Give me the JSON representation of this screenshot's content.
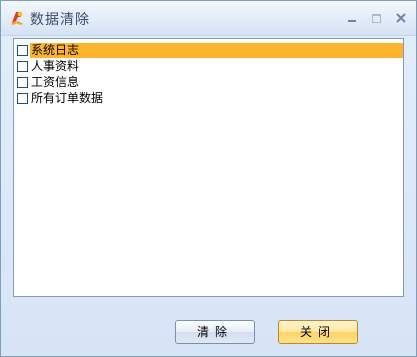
{
  "window": {
    "title": "数据清除",
    "app_icon": "app-logo-icon",
    "controls": {
      "minimize_icon": "minimize-icon",
      "maximize_icon": "maximize-icon",
      "close_icon": "close-icon"
    }
  },
  "list": {
    "items": [
      {
        "label": "系统日志",
        "checked": false,
        "selected": true
      },
      {
        "label": "人事资料",
        "checked": false,
        "selected": false
      },
      {
        "label": "工资信息",
        "checked": false,
        "selected": false
      },
      {
        "label": "所有订单数据",
        "checked": false,
        "selected": false
      }
    ]
  },
  "buttons": {
    "clear_label": "清除",
    "close_label": "关闭"
  },
  "colors": {
    "selection": "#ffb42d",
    "window_bg": "#d6e4f6",
    "border": "#7f9db9"
  }
}
